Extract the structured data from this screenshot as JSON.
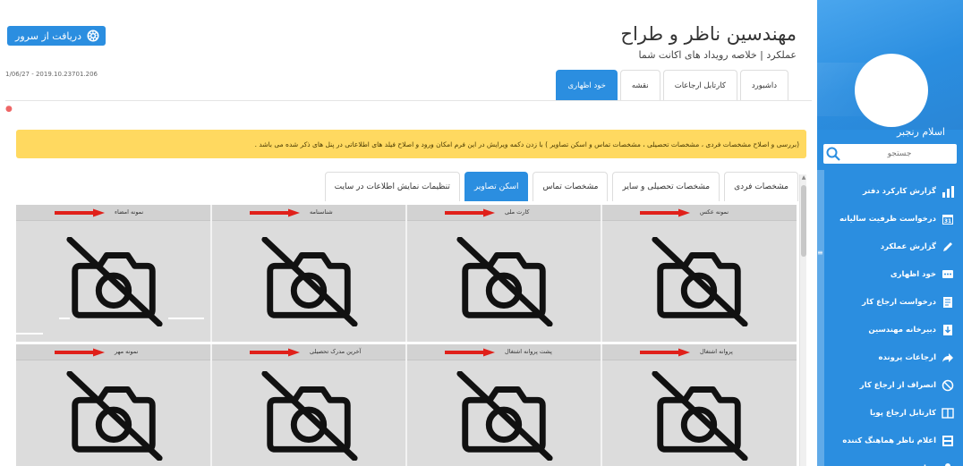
{
  "header": {
    "title": "مهندسین ناظر و طراح",
    "subtitle": "عملکرد | خلاصه رویداد های اکانت شما",
    "server_button": "دریافت از سرور",
    "timestamp": "1/06/27 - 2019.10.23701.206"
  },
  "sidebar": {
    "user_name": "اسلام رنجبر",
    "search_placeholder": "جستجو",
    "items": [
      {
        "label": "گزارش کارکرد دفتر",
        "icon": "chart-icon"
      },
      {
        "label": "درخواست ظرفیت سالیانه",
        "icon": "calendar-icon"
      },
      {
        "label": "گزارش عملکرد",
        "icon": "pen-icon"
      },
      {
        "label": "خود اظهاری",
        "icon": "chat-icon"
      },
      {
        "label": "درخواست ارجاع کار",
        "icon": "document-icon"
      },
      {
        "label": "دبیرخانه مهندسین",
        "icon": "inbox-icon"
      },
      {
        "label": "ارجاعات پرونده",
        "icon": "share-icon"
      },
      {
        "label": "انصراف از ارجاع کار",
        "icon": "cancel-icon"
      },
      {
        "label": "کارتابل ارجاع پویا",
        "icon": "book-icon"
      },
      {
        "label": "اعلام ناظر هماهنگ کننده",
        "icon": "id-card-icon"
      },
      {
        "label": "عوارض مهندس",
        "icon": "user-icon"
      }
    ]
  },
  "top_tabs": [
    {
      "label": "داشبورد",
      "active": false
    },
    {
      "label": "کارتابل ارجاعات",
      "active": false
    },
    {
      "label": "نقشه",
      "active": false
    },
    {
      "label": "خود اظهاری",
      "active": true
    }
  ],
  "notice": "(بررسی و اصلاح مشخصات فردی ، مشخصات تحصیلی ، مشخصات تماس و اسکن تصاویر ) با زدن دکمه ویرایش در این فرم امکان ورود و اصلاح فیلد های اطلاعاتی در پنل های ذکر شده می باشد .",
  "sub_tabs": [
    {
      "label": "مشخصات فردی",
      "active": false
    },
    {
      "label": "مشخصات تحصیلی و سایر",
      "active": false
    },
    {
      "label": "مشخصات تماس",
      "active": false
    },
    {
      "label": "اسکن تصاویر",
      "active": true
    },
    {
      "label": "تنظیمات نمایش اطلاعات در سایت",
      "active": false
    }
  ],
  "image_slots_row1": [
    "نمونه عکس",
    "کارت ملی",
    "شناسنامه",
    "نمونه امضاء"
  ],
  "image_slots_row2": [
    "پروانه اشتغال",
    "پشت پروانه اشتغال",
    "آخرین مدرک تحصیلی",
    "نمونه مهر"
  ],
  "colors": {
    "accent": "#2b8ee0",
    "notice_bg": "#ffd960",
    "arrow": "#e0201a",
    "placeholder_bg": "#dcdcdc"
  }
}
